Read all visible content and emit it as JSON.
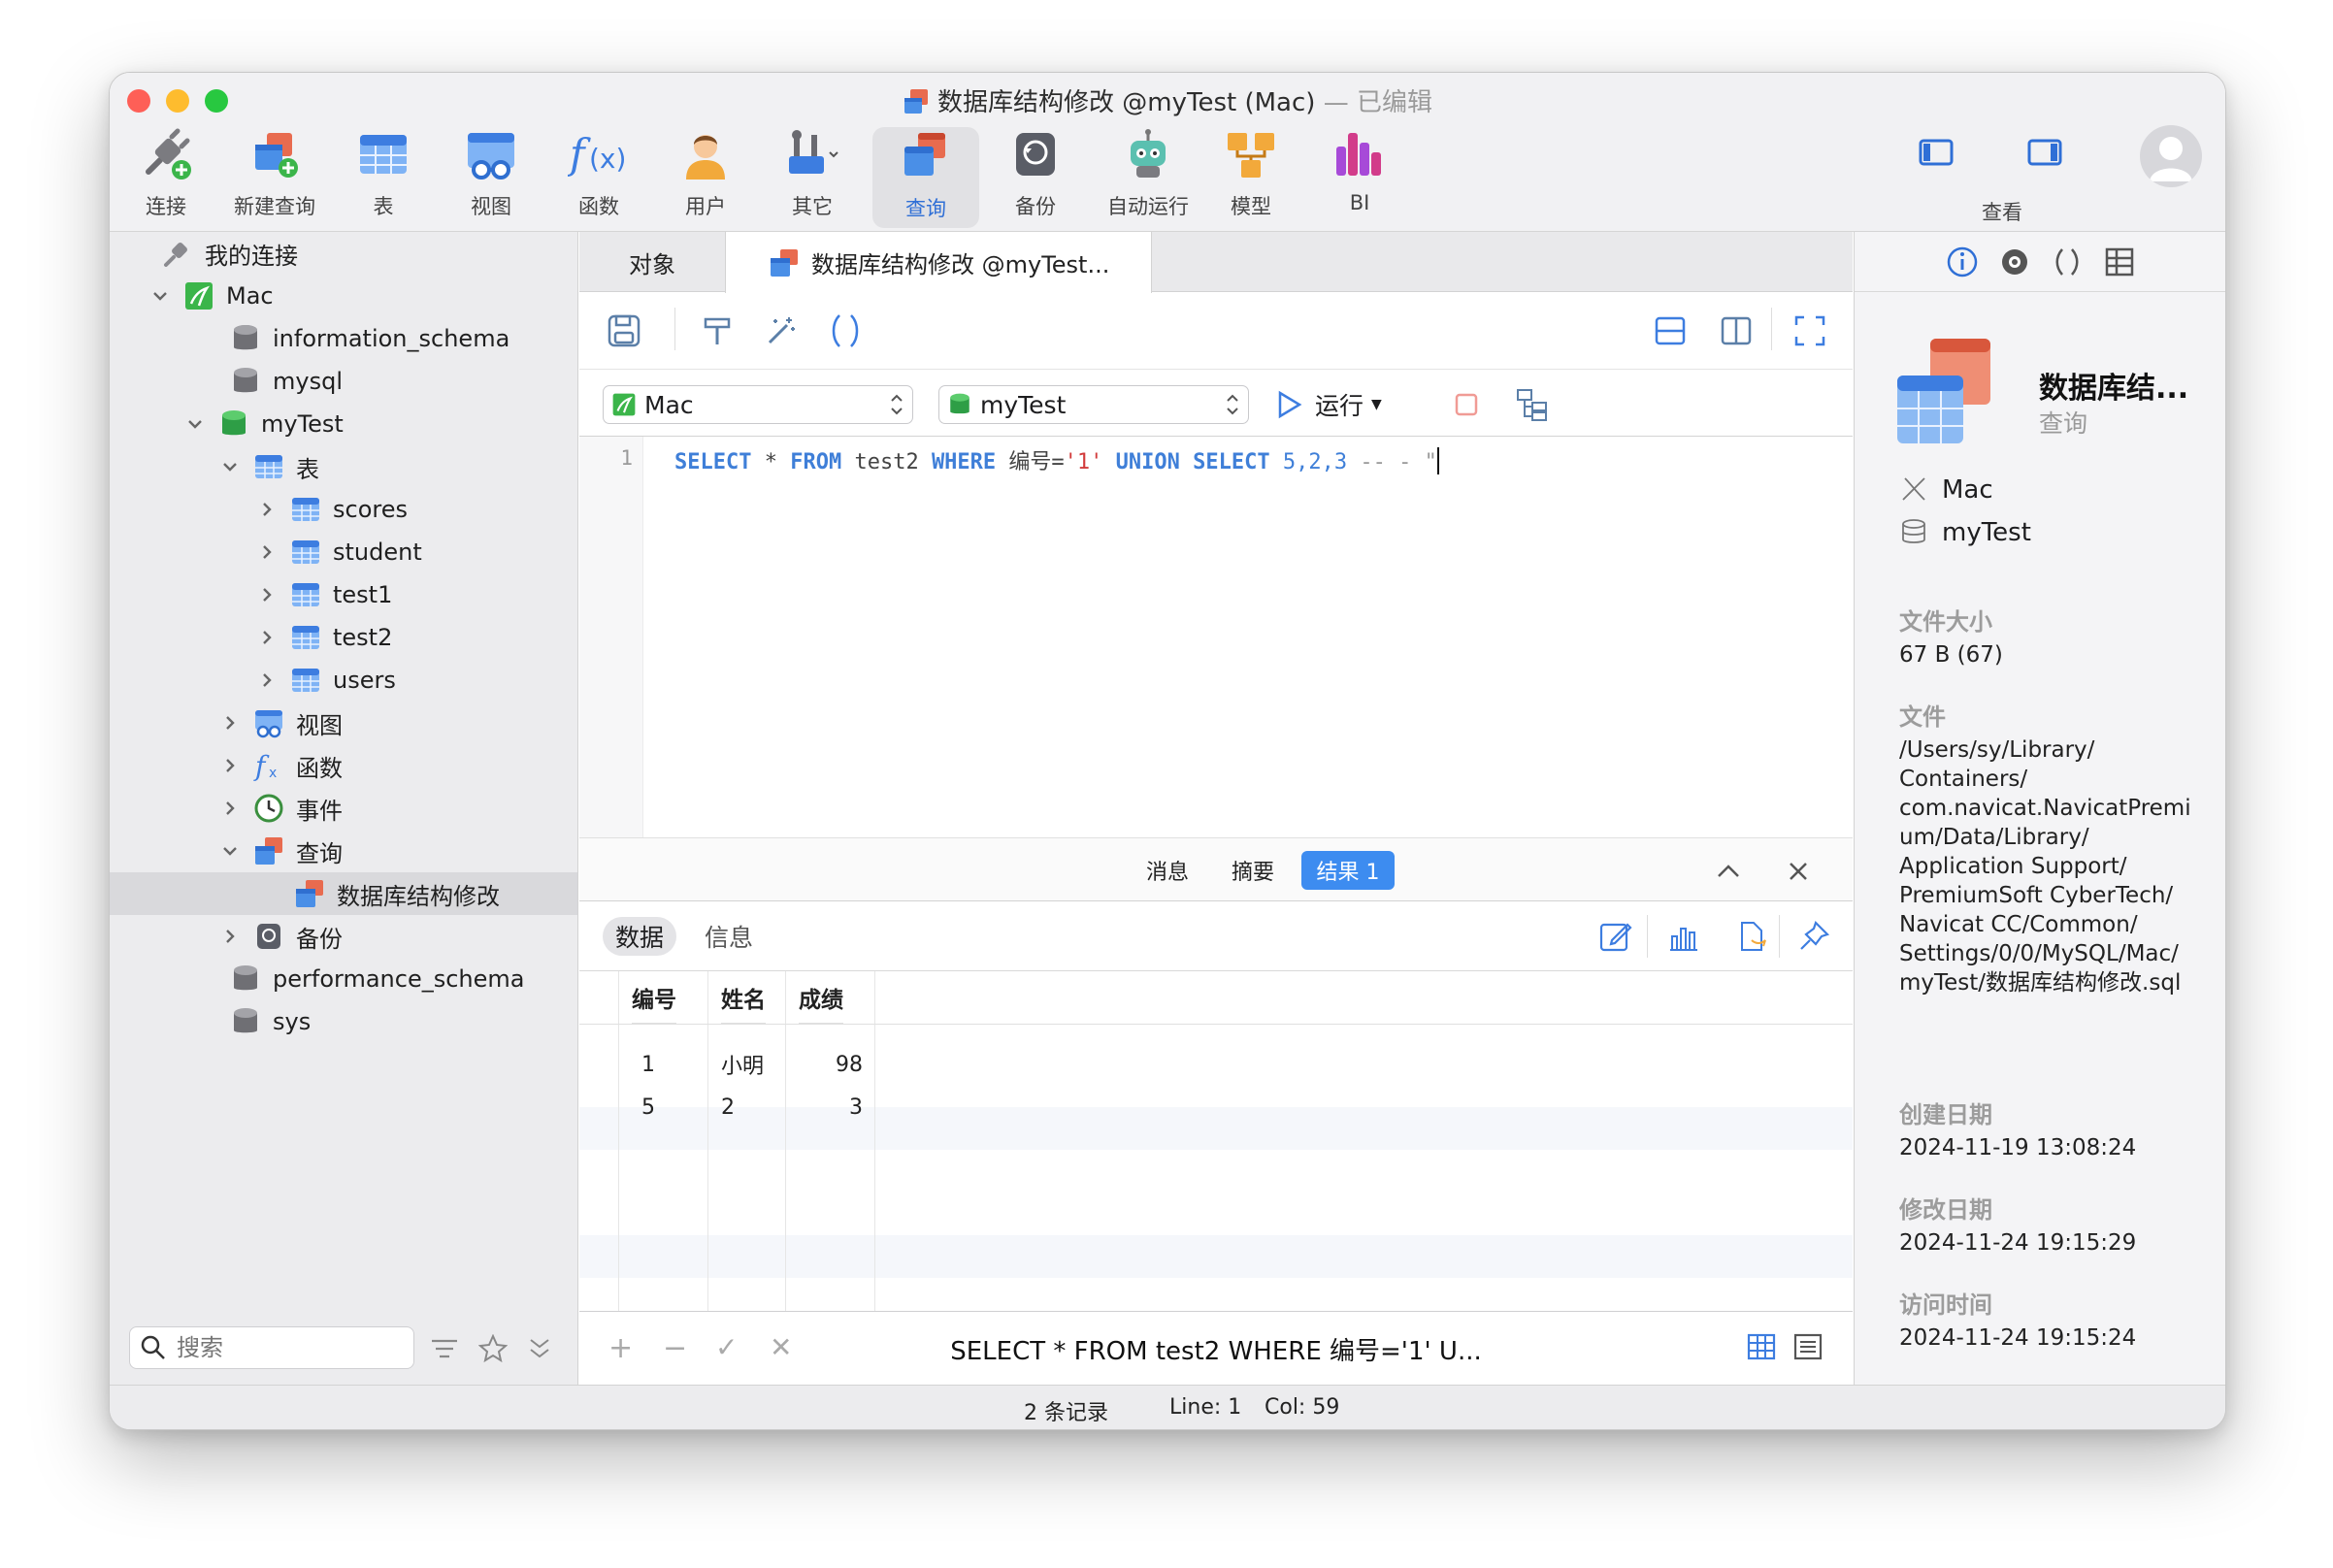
{
  "window": {
    "title": "数据库结构修改 @myTest (Mac)",
    "title_suffix": "— 已编辑"
  },
  "toolbar": {
    "items": [
      {
        "label": "连接",
        "icon": "connection-icon"
      },
      {
        "label": "新建查询",
        "icon": "new-query-icon"
      },
      {
        "label": "表",
        "icon": "table-icon"
      },
      {
        "label": "视图",
        "icon": "view-icon"
      },
      {
        "label": "函数",
        "icon": "function-icon"
      },
      {
        "label": "用户",
        "icon": "user-icon"
      },
      {
        "label": "其它",
        "icon": "tools-icon"
      },
      {
        "label": "查询",
        "icon": "query-icon"
      },
      {
        "label": "备份",
        "icon": "backup-icon"
      },
      {
        "label": "自动运行",
        "icon": "robot-icon"
      },
      {
        "label": "模型",
        "icon": "model-icon"
      },
      {
        "label": "BI",
        "icon": "bi-icon"
      }
    ],
    "view_label": "查看",
    "active": "查询"
  },
  "sidebar": {
    "header": "我的连接",
    "connection": "Mac",
    "databases": [
      "information_schema",
      "mysql",
      "myTest",
      "performance_schema",
      "sys"
    ],
    "mytest_children": {
      "tables_label": "表",
      "tables": [
        "scores",
        "student",
        "test1",
        "test2",
        "users"
      ],
      "views_label": "视图",
      "functions_label": "函数",
      "events_label": "事件",
      "queries_label": "查询",
      "query_item": "数据库结构修改",
      "backups_label": "备份"
    },
    "search_placeholder": "搜索"
  },
  "tabs": {
    "objects": "对象",
    "query_tab": "数据库结构修改 @myTest..."
  },
  "editor": {
    "connection": "Mac",
    "database": "myTest",
    "run_label": "运行",
    "line_number": "1",
    "sql_tokens": {
      "kw1": "SELECT",
      "star": " * ",
      "kw2": "FROM",
      "tbl": " test2 ",
      "kw3": "WHERE",
      "col": " 编号=",
      "str": "'1'",
      "sp": " ",
      "kw4": "UNION",
      "sp2": " ",
      "kw5": "SELECT",
      "nums": " 5,2,3",
      "comment": " -- - \""
    }
  },
  "results": {
    "tabs": [
      "消息",
      "摘要",
      "结果 1"
    ],
    "active_tab": "结果 1",
    "subtabs": [
      "数据",
      "信息"
    ],
    "columns": [
      "编号",
      "姓名",
      "成绩"
    ],
    "rows": [
      [
        "1",
        "小明",
        "98"
      ],
      [
        "5",
        "2",
        "3"
      ]
    ],
    "bottom_sql": "SELECT * FROM test2 WHERE 编号='1' U..."
  },
  "info_panel": {
    "name": "数据库结...",
    "type": "查询",
    "connection": "Mac",
    "database": "myTest",
    "size_label": "文件大小",
    "size": "67 B (67)",
    "file_label": "文件",
    "file_lines": [
      "/Users/sy/Library/",
      "Containers/",
      "com.navicat.NavicatPremi",
      "um/Data/Library/",
      "Application Support/",
      "PremiumSoft CyberTech/",
      "Navicat CC/Common/",
      "Settings/0/0/MySQL/Mac/",
      "myTest/数据库结构修改.sql"
    ],
    "created_label": "创建日期",
    "created": "2024-11-19 13:08:24",
    "modified_label": "修改日期",
    "modified": "2024-11-24 19:15:29",
    "accessed_label": "访问时间",
    "accessed": "2024-11-24 19:15:24"
  },
  "status": {
    "records": "2 条记录",
    "line": "Line: 1",
    "col": "Col: 59"
  },
  "colors": {
    "accent": "#3d8cf0",
    "close": "#fe5f57",
    "minimize": "#febc2e",
    "zoom": "#28c840"
  }
}
